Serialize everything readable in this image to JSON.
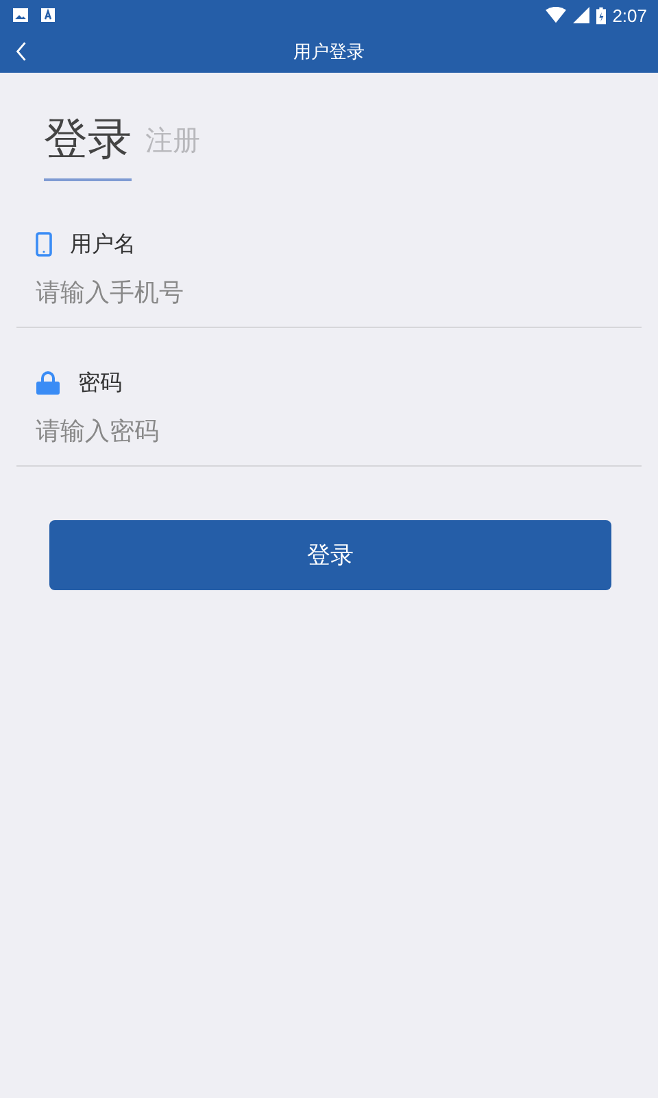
{
  "status_bar": {
    "time": "2:07"
  },
  "app_bar": {
    "title": "用户登录"
  },
  "tabs": [
    {
      "label": "登录",
      "selected": true
    },
    {
      "label": "注册",
      "selected": false
    }
  ],
  "fields": [
    {
      "kind": "phone",
      "label": "用户名",
      "placeholder": "请输入手机号"
    },
    {
      "kind": "lock",
      "label": "密码",
      "placeholder": "请输入密码"
    }
  ],
  "submit_button": "登录"
}
